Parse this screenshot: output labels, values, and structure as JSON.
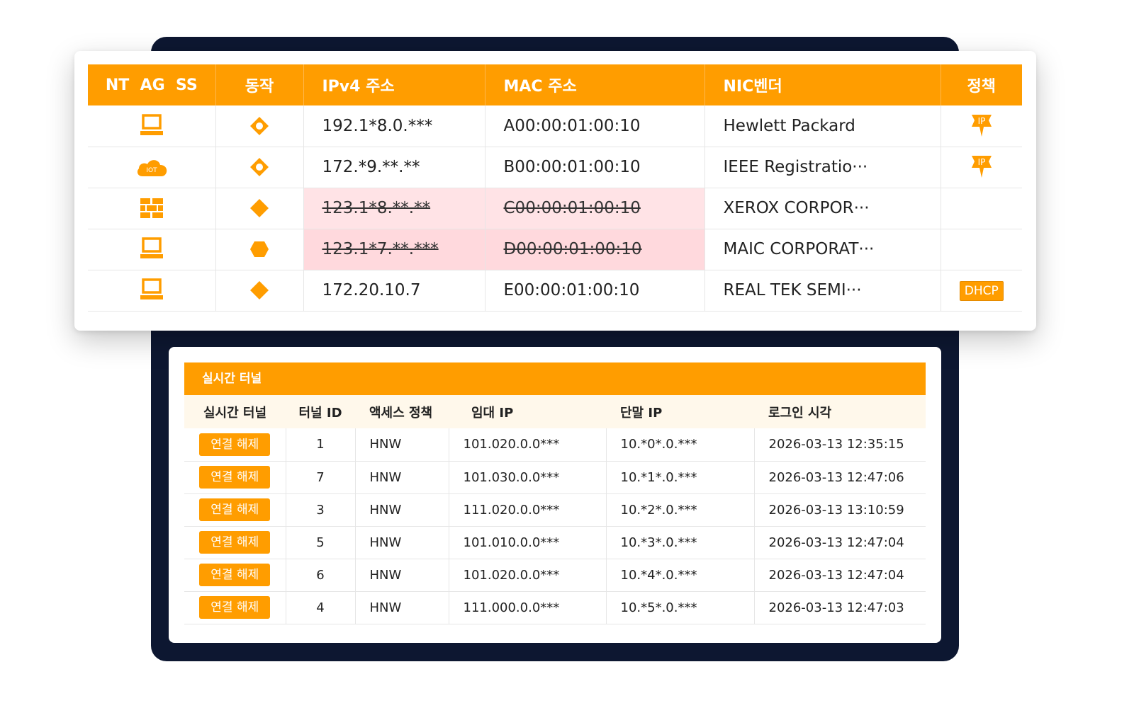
{
  "colors": {
    "accent": "#ff9d00",
    "frame": "#0d1731",
    "blocked_row": "#ffe3e6"
  },
  "device_table": {
    "headers": {
      "type": "NT  AG  SS",
      "action": "동작",
      "ipv4": "IPv4 주소",
      "mac": "MAC 주소",
      "vendor": "NIC벤더",
      "policy": "정책"
    },
    "rows": [
      {
        "type_icon": "laptop-icon",
        "action_icon": "diamond-outline-icon",
        "ipv4": "192.1*8.0.***",
        "mac": "A00:00:01:00:10",
        "vendor": "Hewlett Packard",
        "policy_icon": "ip-pin-icon",
        "policy_text": "IP",
        "blocked": false
      },
      {
        "type_icon": "iot-cloud-icon",
        "type_text": "IOT",
        "action_icon": "diamond-outline-icon",
        "ipv4": "172.*9.**.**",
        "mac": "B00:00:01:00:10",
        "vendor": "IEEE Registratio···",
        "policy_icon": "ip-pin-icon",
        "policy_text": "IP",
        "blocked": false
      },
      {
        "type_icon": "firewall-icon",
        "action_icon": "diamond-filled-icon",
        "ipv4": "123.1*8.**.**",
        "mac": "C00:00:01:00:10",
        "vendor": "XEROX CORPOR···",
        "policy_icon": "",
        "blocked": true
      },
      {
        "type_icon": "laptop-icon",
        "action_icon": "hexagon-filled-icon",
        "ipv4": "123.1*7.**.***",
        "mac": "D00:00:01:00:10",
        "vendor": "MAIC CORPORAT···",
        "policy_icon": "",
        "blocked": true
      },
      {
        "type_icon": "laptop-icon",
        "action_icon": "diamond-filled-icon",
        "ipv4": "172.20.10.7",
        "mac": "E00:00:01:00:10",
        "vendor": "REAL TEK SEMI···",
        "policy_badge": "DHCP",
        "blocked": false
      }
    ]
  },
  "tunnel_panel": {
    "title": "실시간 터널",
    "headers": {
      "tunnel": "실시간 터널",
      "tunnel_id": "터널 ID",
      "access_policy": "액세스 정책",
      "lease_ip": "임대 IP",
      "terminal_ip": "단말 IP",
      "login_time": "로그인 시각"
    },
    "rows": [
      {
        "button": "연결 해제",
        "id": "1",
        "policy": "HNW",
        "lease_ip": "101.020.0.0***",
        "terminal_ip": "10.*0*.0.***",
        "login": "2026-03-13 12:35:15"
      },
      {
        "button": "연결 해제",
        "id": "7",
        "policy": "HNW",
        "lease_ip": "101.030.0.0***",
        "terminal_ip": "10.*1*.0.***",
        "login": "2026-03-13 12:47:06"
      },
      {
        "button": "연결 해제",
        "id": "3",
        "policy": "HNW",
        "lease_ip": "111.020.0.0***",
        "terminal_ip": "10.*2*.0.***",
        "login": "2026-03-13 13:10:59"
      },
      {
        "button": "연결 해제",
        "id": "5",
        "policy": "HNW",
        "lease_ip": "101.010.0.0***",
        "terminal_ip": "10.*3*.0.***",
        "login": "2026-03-13 12:47:04"
      },
      {
        "button": "연결 해제",
        "id": "6",
        "policy": "HNW",
        "lease_ip": "101.020.0.0***",
        "terminal_ip": "10.*4*.0.***",
        "login": "2026-03-13 12:47:04"
      },
      {
        "button": "연결 해제",
        "id": "4",
        "policy": "HNW",
        "lease_ip": "111.000.0.0***",
        "terminal_ip": "10.*5*.0.***",
        "login": "2026-03-13 12:47:03"
      }
    ]
  }
}
